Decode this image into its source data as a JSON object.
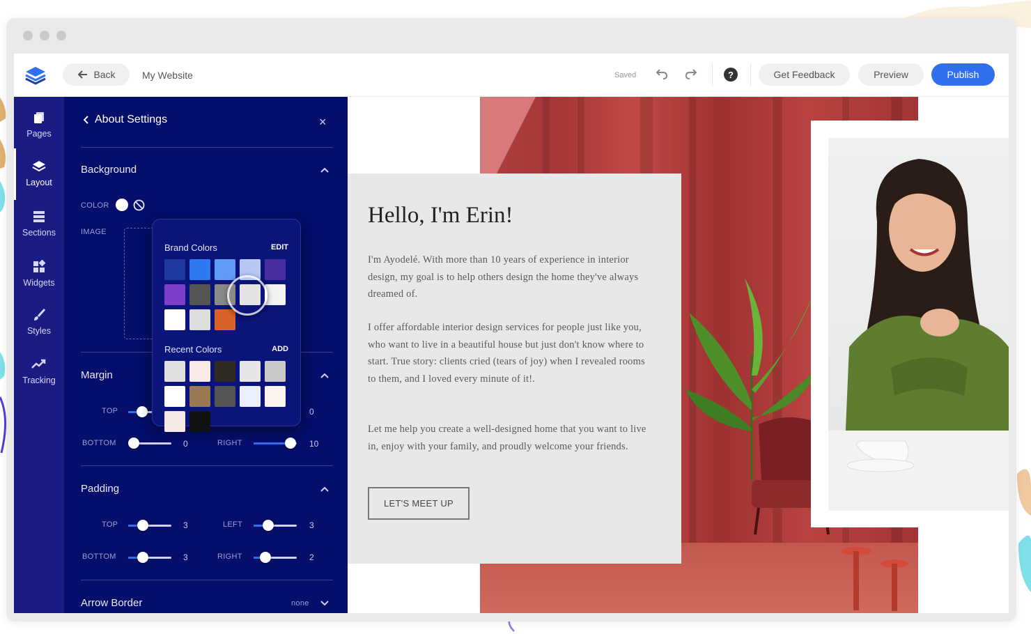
{
  "topbar": {
    "back_label": "Back",
    "site_name": "My Website",
    "saved_label": "Saved",
    "help_label": "?",
    "feedback_label": "Get Feedback",
    "preview_label": "Preview",
    "publish_label": "Publish",
    "accent_color": "#2f6ff0"
  },
  "rail": {
    "items": [
      {
        "label": "Pages",
        "icon": "pages-icon"
      },
      {
        "label": "Layout",
        "icon": "layers-icon",
        "active": true
      },
      {
        "label": "Sections",
        "icon": "sections-icon"
      },
      {
        "label": "Widgets",
        "icon": "widgets-icon"
      },
      {
        "label": "Styles",
        "icon": "brush-icon"
      },
      {
        "label": "Tracking",
        "icon": "trending-icon"
      }
    ]
  },
  "panel": {
    "title": "About Settings",
    "close_label": "×",
    "background": {
      "title": "Background",
      "color_label": "COLOR",
      "image_label": "IMAGE"
    },
    "margin": {
      "title": "Margin",
      "top_label": "TOP",
      "top_value": "0",
      "bottom_label": "BOTTOM",
      "bottom_value": "0",
      "right_label": "RIGHT",
      "right_value": "10",
      "left_value": "0"
    },
    "padding": {
      "title": "Padding",
      "top_label": "TOP",
      "top_value": "3",
      "left_label": "LEFT",
      "left_value": "3",
      "bottom_label": "BOTTOM",
      "bottom_value": "3",
      "right_label": "RIGHT",
      "right_value": "2"
    },
    "arrow_border": {
      "title": "Arrow Border",
      "value": "none"
    }
  },
  "color_picker": {
    "brand_title": "Brand Colors",
    "brand_action": "EDIT",
    "brand_colors": [
      "#1f3a9e",
      "#2f7af0",
      "#5f9af5",
      "#b8c8f6",
      "#4a2da0",
      "#7b3fc9",
      "#555555",
      "#8a8a8a",
      "#e4e4e4",
      "#f3f3f3",
      "#ffffff",
      "#dddddd",
      "#d9612a"
    ],
    "recent_title": "Recent Colors",
    "recent_action": "ADD",
    "recent_colors": [
      "#e0e0e0",
      "#f8e9e6",
      "#2f2a22",
      "#e6e6e6",
      "#c9c9c9",
      "#ffffff",
      "#9b7a52",
      "#555555",
      "#e9efff",
      "#fbf3ec",
      "#f6e8e4",
      "#121212"
    ]
  },
  "preview": {
    "heading": "Hello, I'm Erin!",
    "paragraph1": "I'm Ayodelé. With more than 10 years of experience in interior design, my goal is to help others design the home they've always dreamed of.",
    "paragraph2": "I offer affordable interior design services for people just like you, who want to live in a beautiful house but just don't know where to start. True story: clients cried (tears of joy) when I revealed rooms to them, and I loved every minute of it!.",
    "paragraph3": "Let me help you create a well-designed home that you want to live in, enjoy with your family, and proudly welcome your friends.",
    "cta_label": "LET'S MEET UP"
  }
}
